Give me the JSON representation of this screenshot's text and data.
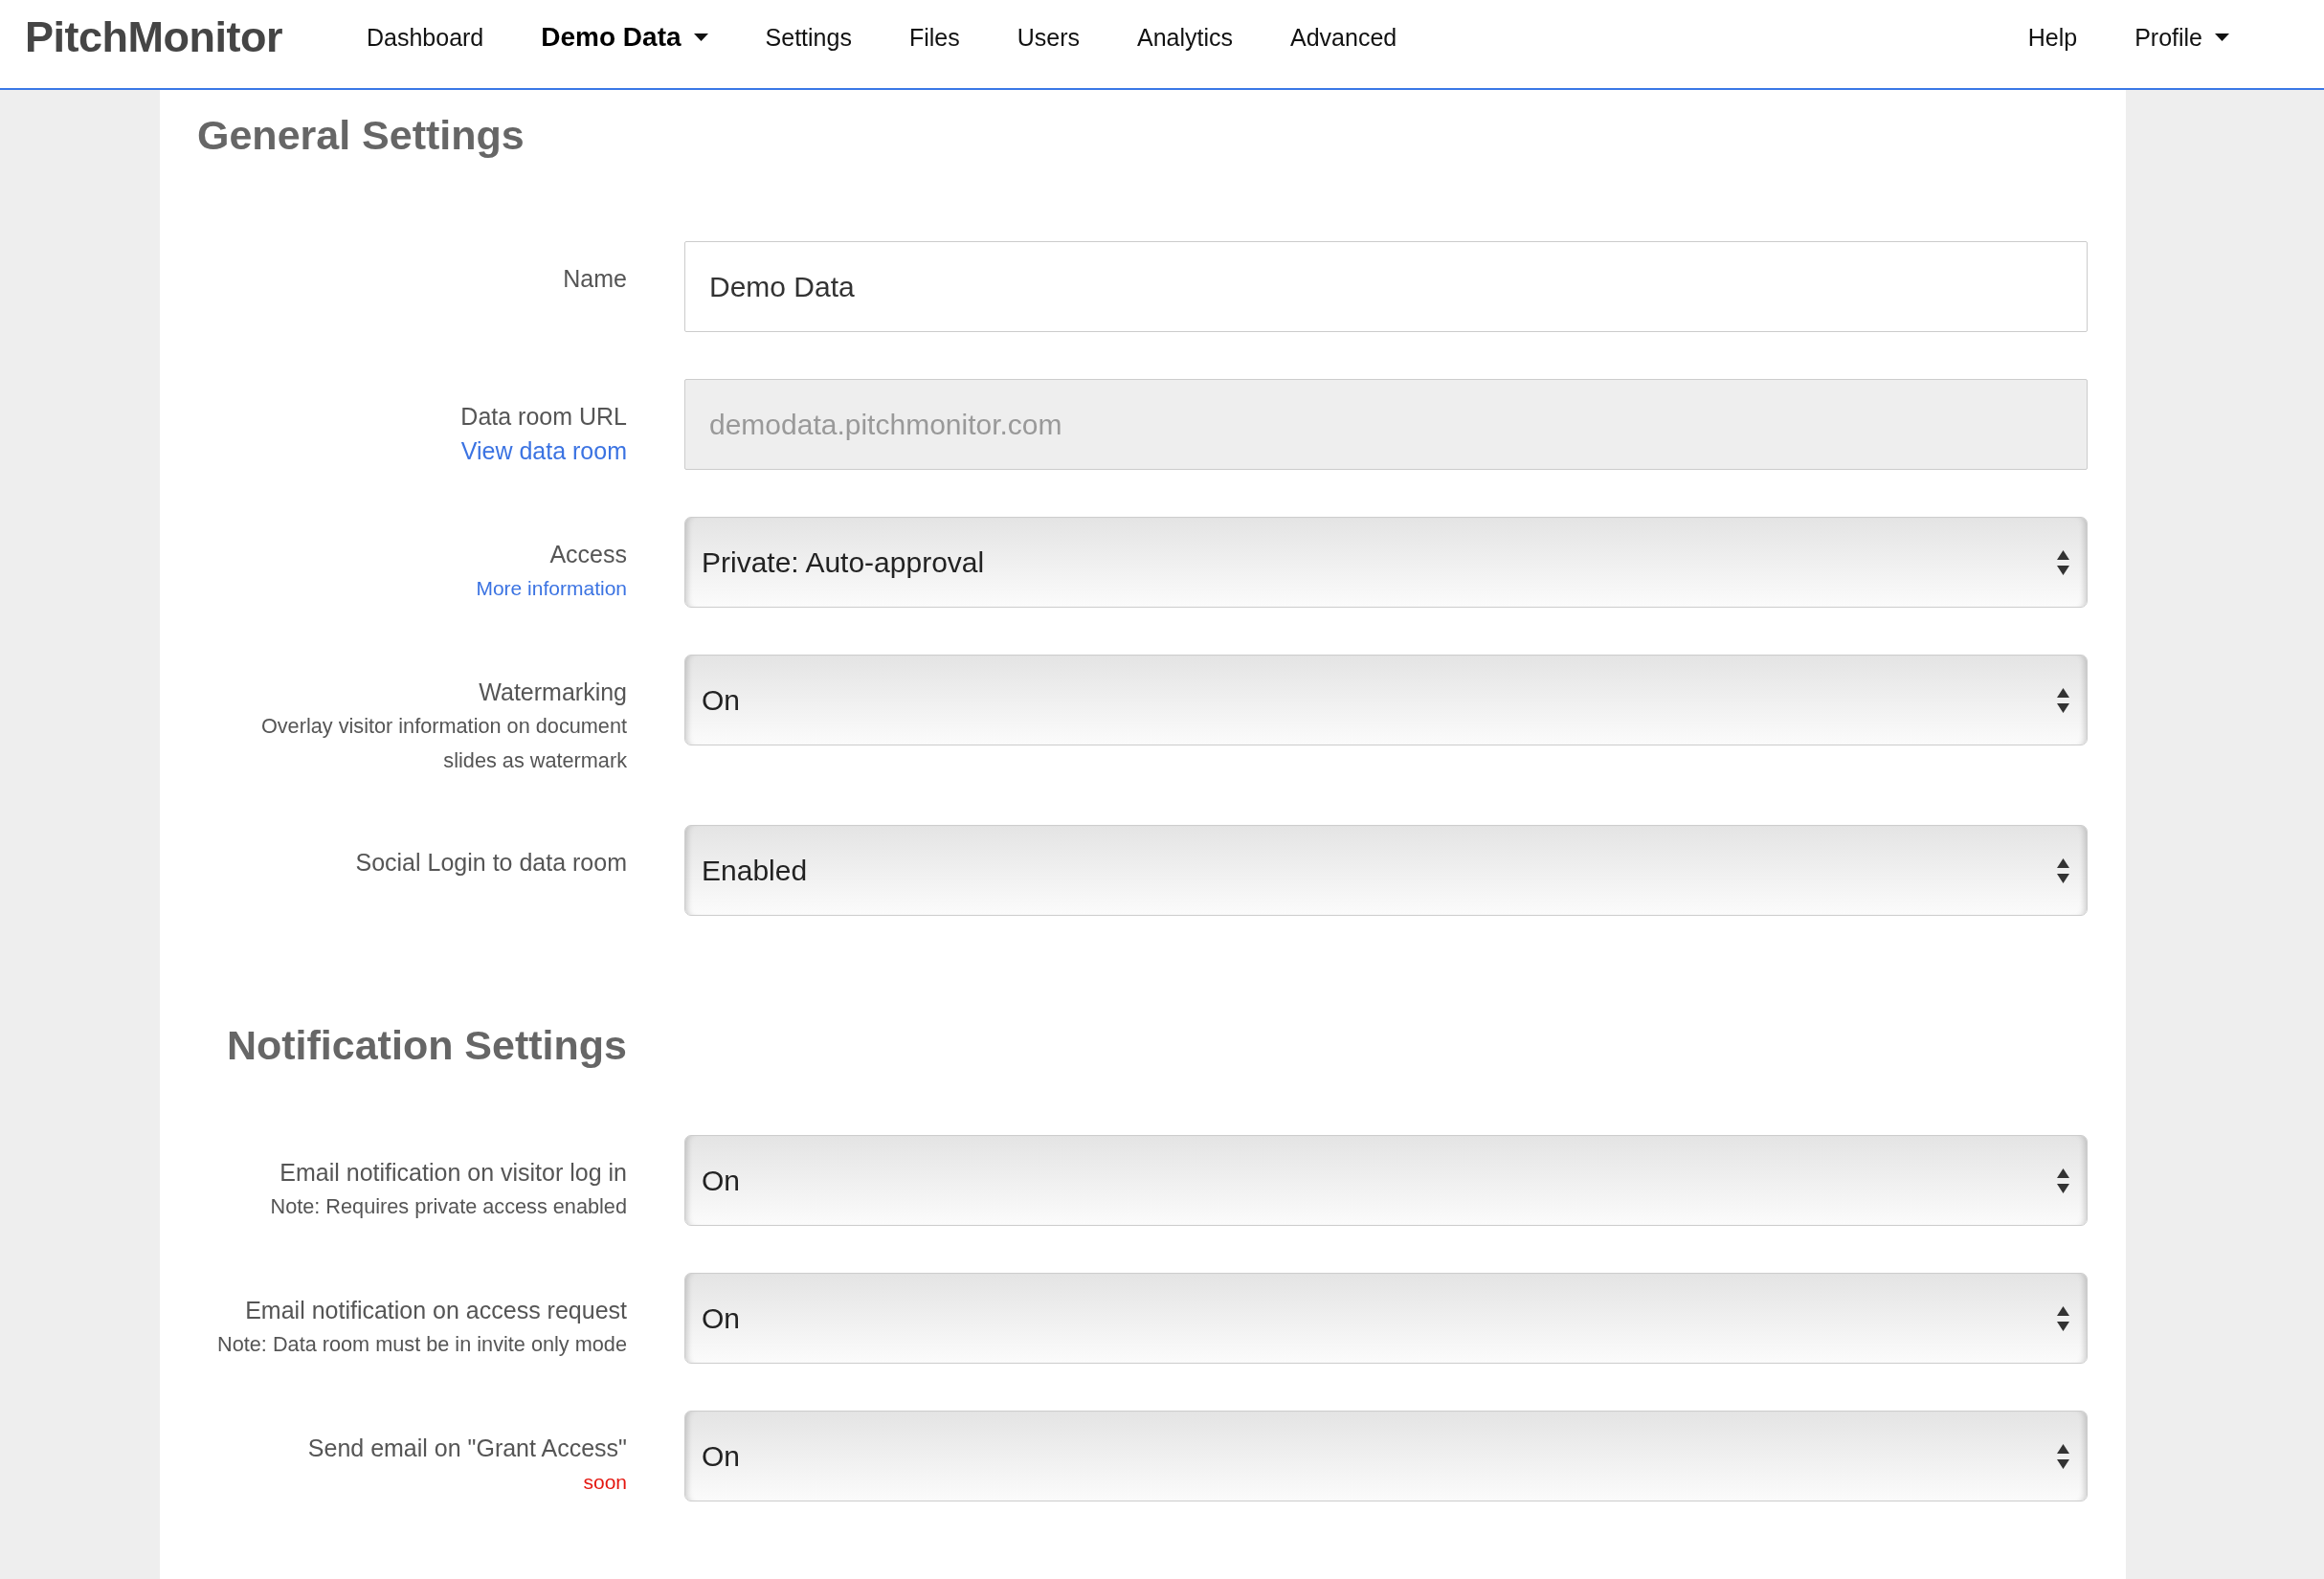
{
  "nav": {
    "logo": "PitchMonitor",
    "items": [
      {
        "label": "Dashboard",
        "selected": false,
        "dropdown": false
      },
      {
        "label": "Demo Data",
        "selected": true,
        "dropdown": true
      },
      {
        "label": "Settings",
        "selected": false,
        "dropdown": false
      },
      {
        "label": "Files",
        "selected": false,
        "dropdown": false
      },
      {
        "label": "Users",
        "selected": false,
        "dropdown": false
      },
      {
        "label": "Analytics",
        "selected": false,
        "dropdown": false
      },
      {
        "label": "Advanced",
        "selected": false,
        "dropdown": false
      }
    ],
    "right_items": [
      {
        "label": "Help",
        "dropdown": false
      },
      {
        "label": "Profile",
        "dropdown": true
      }
    ]
  },
  "sections": [
    {
      "title": "General Settings",
      "kind": "page_title",
      "fields": [
        {
          "label": "Name",
          "kind": "text",
          "value": "Demo Data",
          "disabled": false
        },
        {
          "label": "Data room URL",
          "link": "View data room",
          "kind": "text",
          "placeholder": "demodata.pitchmonitor.com",
          "disabled": true
        },
        {
          "label": "Access",
          "help_link": "More information",
          "kind": "select",
          "value": "Private: Auto-approval",
          "disabled": false
        },
        {
          "label": "Watermarking",
          "note": "Overlay visitor information on document slides as watermark",
          "kind": "select",
          "value": "On",
          "disabled": false
        },
        {
          "label": "Social Login to data room",
          "kind": "select",
          "value": "Enabled",
          "disabled": false
        }
      ]
    },
    {
      "title": "Notification Settings",
      "kind": "row_title",
      "fields": [
        {
          "label": "Email notification on visitor log in",
          "note": "Note: Requires private access enabled",
          "kind": "select",
          "value": "On",
          "disabled": false
        },
        {
          "label": "Email notification on access request",
          "note": "Note: Data room must be in invite only mode",
          "kind": "select",
          "value": "On",
          "disabled": false
        },
        {
          "label": "Send email on \"Grant Access\"",
          "flag": "soon",
          "kind": "select",
          "value": "On",
          "disabled": false
        }
      ]
    }
  ]
}
